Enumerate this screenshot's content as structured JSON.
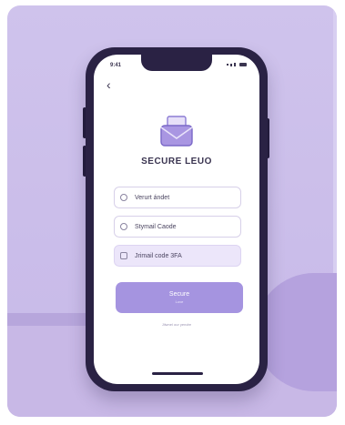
{
  "status_bar": {
    "time": "9:41"
  },
  "nav": {
    "back_icon": "chevron-left-icon",
    "back_glyph": "‹"
  },
  "app": {
    "logo_icon": "envelope-icon",
    "title": "SECURE LEUO"
  },
  "form": {
    "fields": [
      {
        "icon": "user-icon",
        "value": "Verurt ándet"
      },
      {
        "icon": "mail-icon",
        "value": "Stymail Caode"
      },
      {
        "icon": "lock-icon",
        "value": "Jrimail code 3FA"
      }
    ],
    "submit_label": "Secure",
    "submit_sublabel": "Love",
    "footer_link": "Jilwnel our yendre"
  },
  "colors": {
    "background": "#cfc3ec",
    "phone_frame": "#2a2244",
    "accent": "#a594e0",
    "field_highlight": "#ece6fa"
  }
}
